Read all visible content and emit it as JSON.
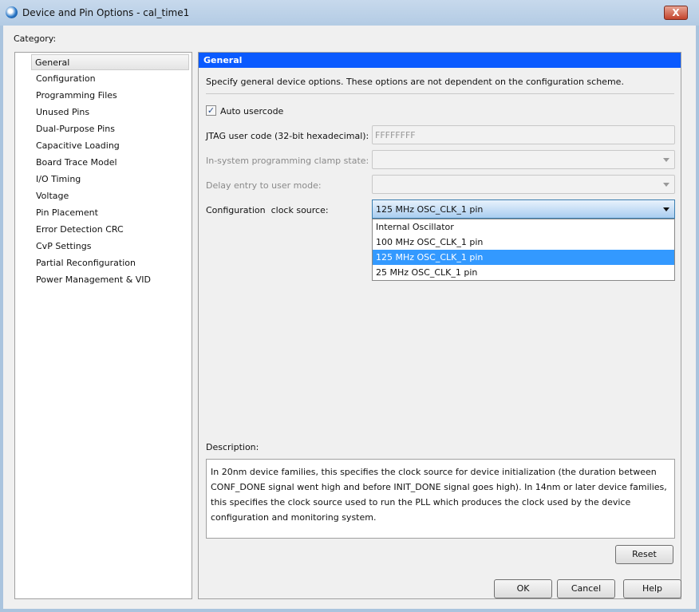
{
  "window": {
    "title": "Device and Pin Options - cal_time1",
    "close": "X"
  },
  "category_label": "Category:",
  "categories": [
    "General",
    "Configuration",
    "Programming Files",
    "Unused Pins",
    "Dual-Purpose Pins",
    "Capacitive Loading",
    "Board Trace Model",
    "I/O Timing",
    "Voltage",
    "Pin Placement",
    "Error Detection CRC",
    "CvP Settings",
    "Partial Reconfiguration",
    "Power Management & VID"
  ],
  "panel": {
    "title": "General",
    "intro": "Specify general device options. These options are not dependent on the configuration scheme.",
    "auto_usercode": {
      "label": "Auto usercode",
      "checked": true
    },
    "jtag": {
      "label": "JTAG user code (32-bit hexadecimal):",
      "value": "FFFFFFFF"
    },
    "clamp": {
      "label": "In-system programming clamp state:",
      "value": ""
    },
    "delay": {
      "label": "Delay entry to user mode:",
      "value": ""
    },
    "clock": {
      "label": "Configuration  clock source:",
      "value": "125 MHz OSC_CLK_1 pin",
      "options": [
        "Internal Oscillator",
        "100 MHz OSC_CLK_1 pin",
        "125 MHz OSC_CLK_1 pin",
        "25 MHz OSC_CLK_1 pin"
      ]
    },
    "description_label": "Description:",
    "description": "In 20nm device families, this specifies the clock source for device initialization (the duration between CONF_DONE signal went high and before INIT_DONE signal goes high). In 14nm or later device families, this specifies the clock source used to run the PLL which produces the clock used by the device configuration and monitoring system.",
    "reset": "Reset"
  },
  "buttons": {
    "ok": "OK",
    "cancel": "Cancel",
    "help": "Help"
  }
}
